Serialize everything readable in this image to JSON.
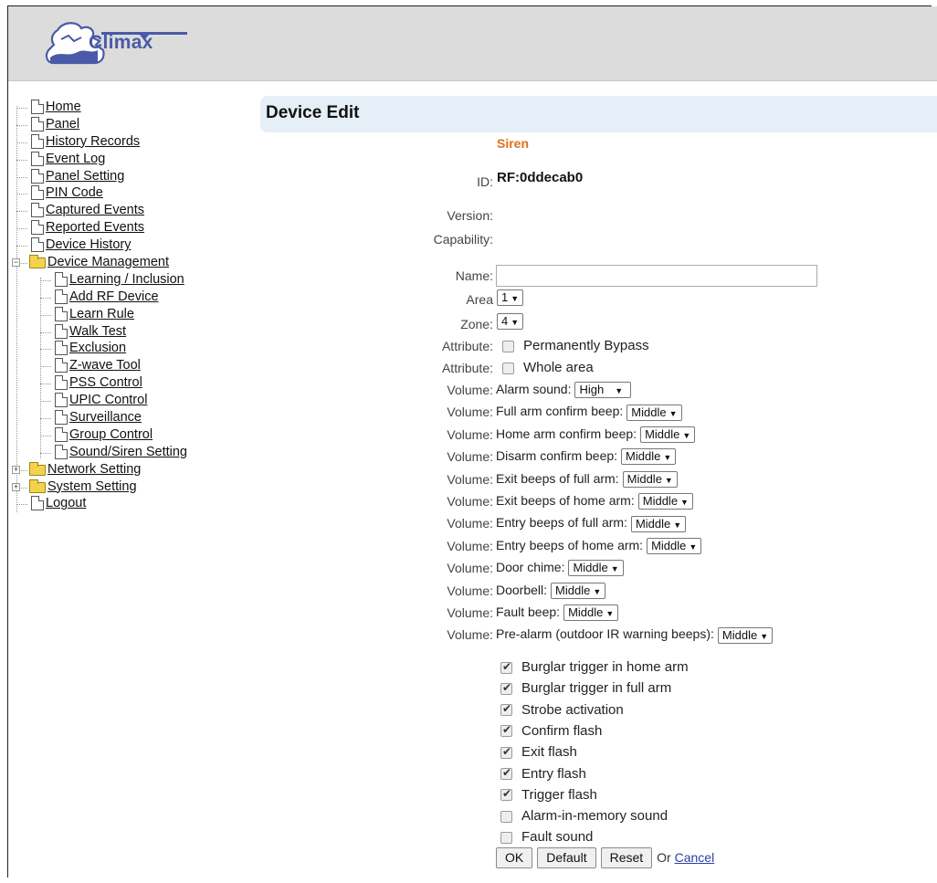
{
  "brand": {
    "logo_text": "Climax"
  },
  "nav": {
    "items": [
      {
        "label": "Home",
        "level": 0,
        "kind": "doc"
      },
      {
        "label": "Panel",
        "level": 0,
        "kind": "doc"
      },
      {
        "label": "History Records",
        "level": 0,
        "kind": "doc"
      },
      {
        "label": "Event Log",
        "level": 0,
        "kind": "doc"
      },
      {
        "label": "Panel Setting",
        "level": 0,
        "kind": "doc"
      },
      {
        "label": "PIN Code",
        "level": 0,
        "kind": "doc"
      },
      {
        "label": "Captured Events",
        "level": 0,
        "kind": "doc"
      },
      {
        "label": "Reported Events",
        "level": 0,
        "kind": "doc"
      },
      {
        "label": "Device History",
        "level": 0,
        "kind": "doc"
      },
      {
        "label": "Device Management",
        "level": 0,
        "kind": "folder-open"
      },
      {
        "label": "Learning / Inclusion",
        "level": 1,
        "kind": "doc"
      },
      {
        "label": "Add RF Device",
        "level": 1,
        "kind": "doc"
      },
      {
        "label": "Learn Rule",
        "level": 1,
        "kind": "doc"
      },
      {
        "label": "Walk Test",
        "level": 1,
        "kind": "doc"
      },
      {
        "label": "Exclusion",
        "level": 1,
        "kind": "doc"
      },
      {
        "label": "Z-wave Tool",
        "level": 1,
        "kind": "doc"
      },
      {
        "label": "PSS Control",
        "level": 1,
        "kind": "doc"
      },
      {
        "label": "UPIC Control",
        "level": 1,
        "kind": "doc"
      },
      {
        "label": "Surveillance",
        "level": 1,
        "kind": "doc"
      },
      {
        "label": "Group Control",
        "level": 1,
        "kind": "doc"
      },
      {
        "label": "Sound/Siren Setting",
        "level": 1,
        "kind": "doc"
      },
      {
        "label": "Network Setting",
        "level": 0,
        "kind": "folder-closed"
      },
      {
        "label": "System Setting",
        "level": 0,
        "kind": "folder-closed"
      },
      {
        "label": "Logout",
        "level": 0,
        "kind": "doc"
      }
    ]
  },
  "page": {
    "title": "Device Edit",
    "device_type": "Siren"
  },
  "device": {
    "id_label": "ID:",
    "id_value": "RF:0ddecab0",
    "version_label": "Version:",
    "capability_label": "Capability:",
    "name_label": "Name:",
    "name_value": "",
    "area_label": "Area",
    "area_value": "1",
    "zone_label": "Zone:",
    "zone_value": "4",
    "attr_label": "Attribute:",
    "attr1_text": "Permanently Bypass",
    "attr1_checked": false,
    "attr2_text": "Whole area",
    "attr2_checked": false
  },
  "volumes": [
    {
      "label": "Volume:",
      "text": "Alarm sound:",
      "value": "High"
    },
    {
      "label": "Volume:",
      "text": "Full arm confirm beep:",
      "value": "Middle"
    },
    {
      "label": "Volume:",
      "text": "Home arm confirm beep:",
      "value": "Middle"
    },
    {
      "label": "Volume:",
      "text": "Disarm confirm beep:",
      "value": "Middle"
    },
    {
      "label": "Volume:",
      "text": "Exit beeps of full arm:",
      "value": "Middle"
    },
    {
      "label": "Volume:",
      "text": "Exit beeps of home arm:",
      "value": "Middle"
    },
    {
      "label": "Volume:",
      "text": "Entry beeps of full arm:",
      "value": "Middle"
    },
    {
      "label": "Volume:",
      "text": "Entry beeps of home arm:",
      "value": "Middle"
    },
    {
      "label": "Volume:",
      "text": "Door chime:",
      "value": "Middle"
    },
    {
      "label": "Volume:",
      "text": "Doorbell:",
      "value": "Middle"
    },
    {
      "label": "Volume:",
      "text": "Fault beep:",
      "value": "Middle"
    },
    {
      "label": "Volume:",
      "text": "Pre-alarm (outdoor IR warning beeps):",
      "value": "Middle"
    }
  ],
  "options": [
    {
      "label": "Burglar trigger in home arm",
      "checked": true
    },
    {
      "label": "Burglar trigger in full arm",
      "checked": true
    },
    {
      "label": "Strobe activation",
      "checked": true
    },
    {
      "label": "Confirm flash",
      "checked": true
    },
    {
      "label": "Exit flash",
      "checked": true
    },
    {
      "label": "Entry flash",
      "checked": true
    },
    {
      "label": "Trigger flash",
      "checked": true
    },
    {
      "label": "Alarm-in-memory sound",
      "checked": false
    },
    {
      "label": "Fault sound",
      "checked": false
    }
  ],
  "actions": {
    "ok": "OK",
    "default": "Default",
    "reset": "Reset",
    "or": "Or",
    "cancel": "Cancel"
  }
}
